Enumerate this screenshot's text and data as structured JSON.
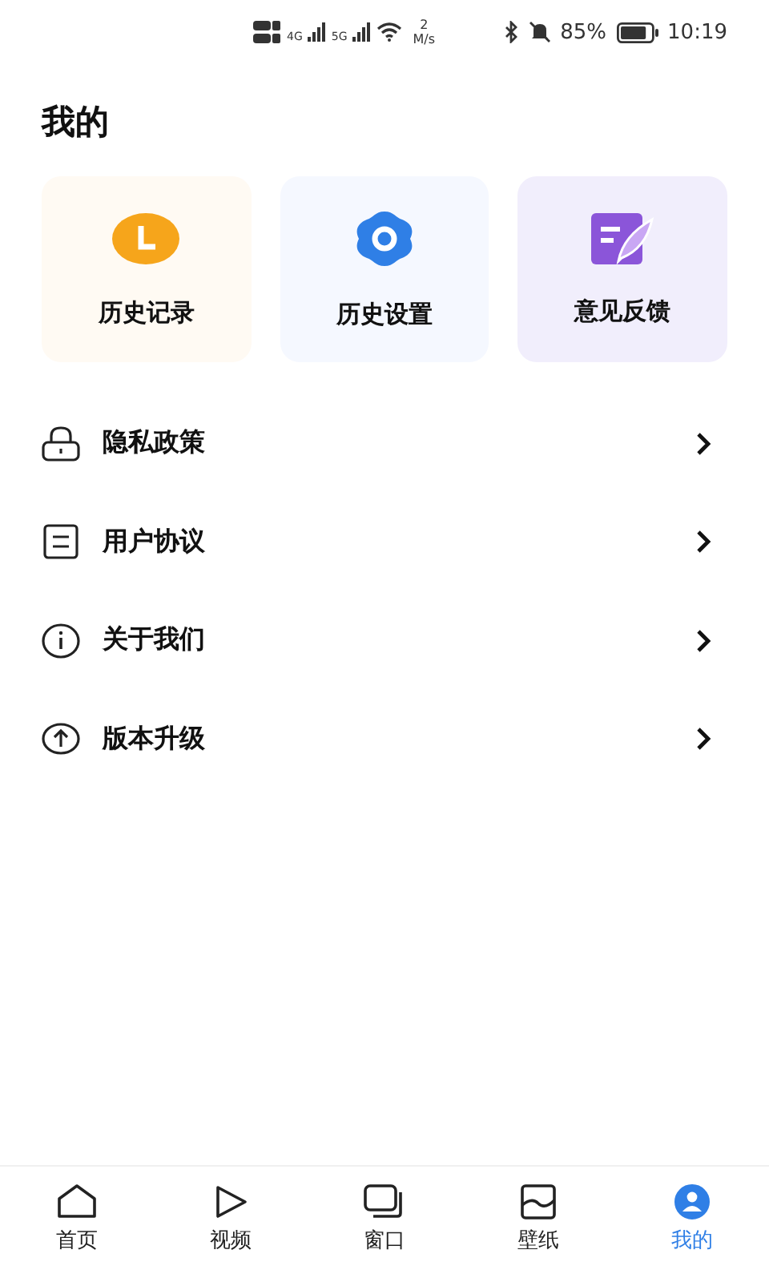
{
  "status_bar": {
    "net1": "4G",
    "net2": "5G",
    "speed_value": "2",
    "speed_unit": "M/s",
    "battery": "85%",
    "time": "10:19"
  },
  "title": "我的",
  "cards": [
    {
      "kind": "clock",
      "label": "历史记录"
    },
    {
      "kind": "gear",
      "label": "历史设置"
    },
    {
      "kind": "feedback",
      "label": "意见反馈"
    }
  ],
  "menu": [
    {
      "kind": "lock",
      "label": "隐私政策"
    },
    {
      "kind": "document",
      "label": "用户协议"
    },
    {
      "kind": "info",
      "label": "关于我们"
    },
    {
      "kind": "upgrade",
      "label": "版本升级"
    }
  ],
  "tabs": [
    {
      "kind": "home",
      "label": "首页",
      "selected": false
    },
    {
      "kind": "video",
      "label": "视频",
      "selected": false
    },
    {
      "kind": "window",
      "label": "窗口",
      "selected": false
    },
    {
      "kind": "wallpaper",
      "label": "壁纸",
      "selected": false
    },
    {
      "kind": "mine",
      "label": "我的",
      "selected": true
    }
  ]
}
